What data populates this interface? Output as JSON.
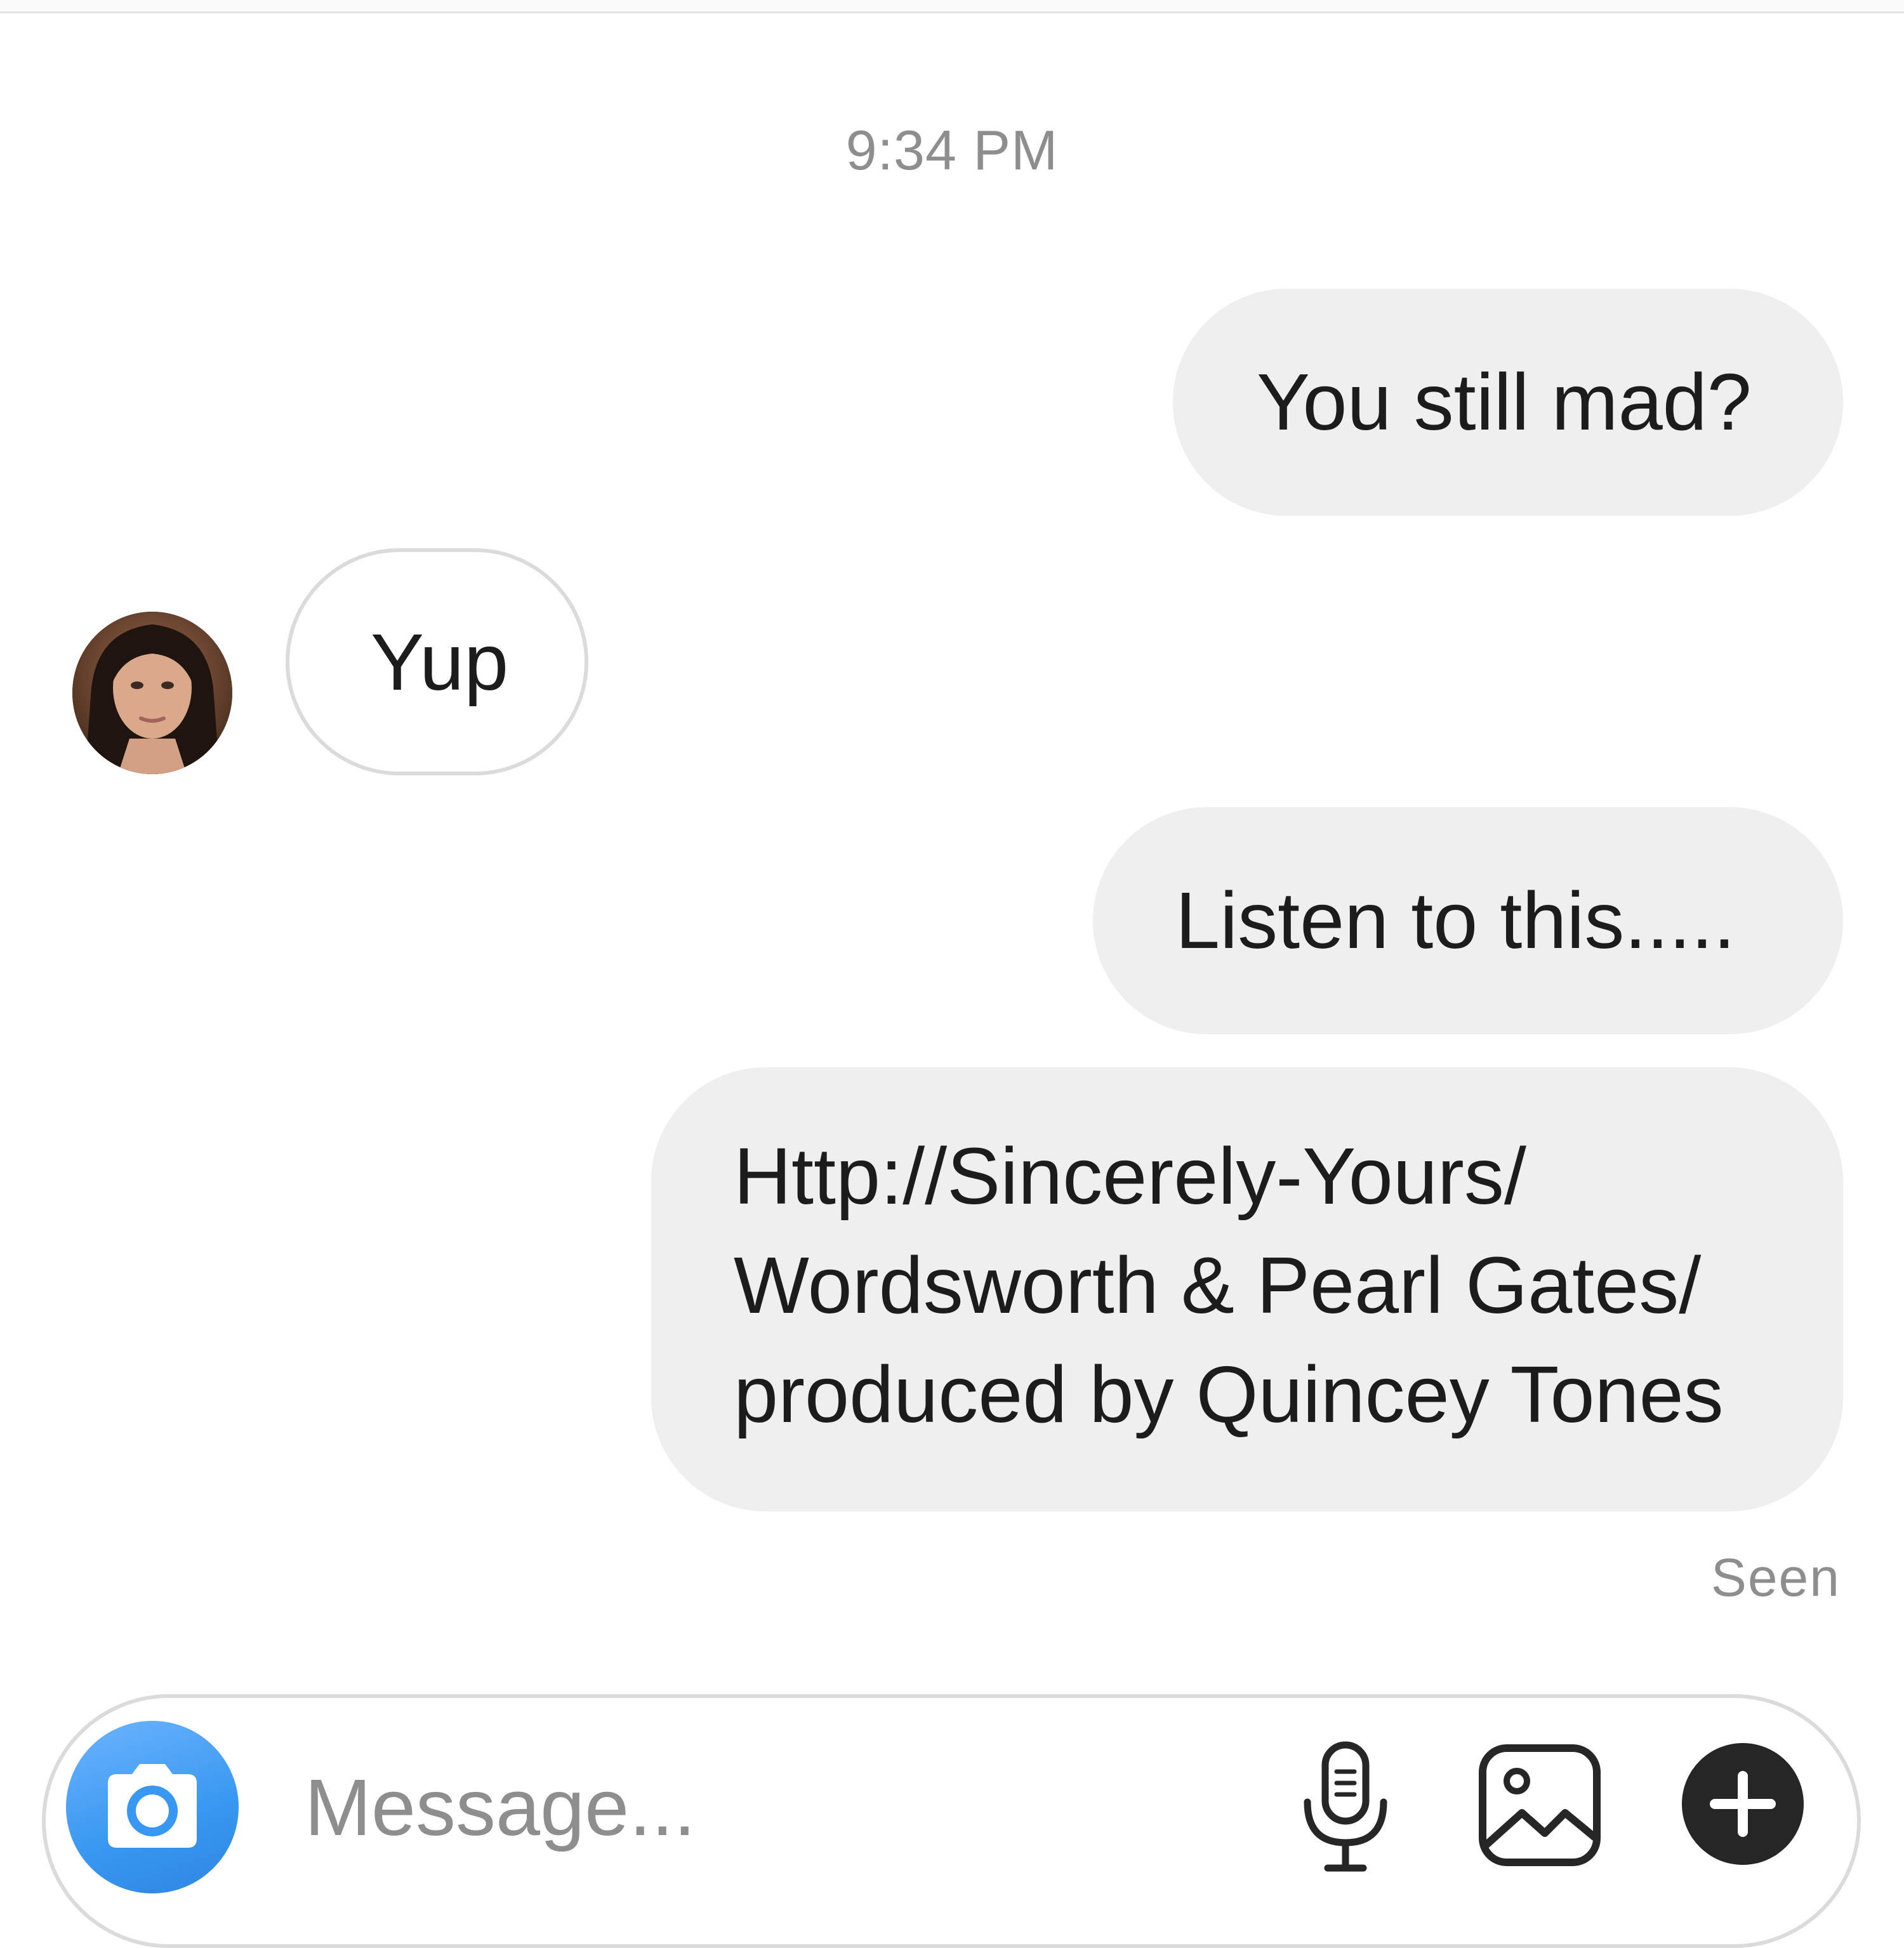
{
  "thread": {
    "timestamp": "9:34 PM",
    "messages": [
      {
        "direction": "outgoing",
        "text": "You still mad?"
      },
      {
        "direction": "incoming",
        "text": "Yup"
      },
      {
        "direction": "outgoing",
        "text": "Listen to this....."
      },
      {
        "direction": "outgoing",
        "lines": [
          "Http://Sincerely-Yours/",
          "Wordsworth & Pearl Gates/",
          "produced by Quincey Tones"
        ]
      }
    ],
    "read_receipt": "Seen"
  },
  "composer": {
    "placeholder": "Message...",
    "value": ""
  },
  "icons": {
    "camera": "camera-icon",
    "mic": "microphone-icon",
    "gallery": "gallery-icon",
    "plus": "plus-icon"
  },
  "colors": {
    "outgoing_bubble": "#efefef",
    "incoming_border": "#dbdbdb",
    "camera_button": "#3897f0",
    "meta_text": "#8e8e8e"
  }
}
